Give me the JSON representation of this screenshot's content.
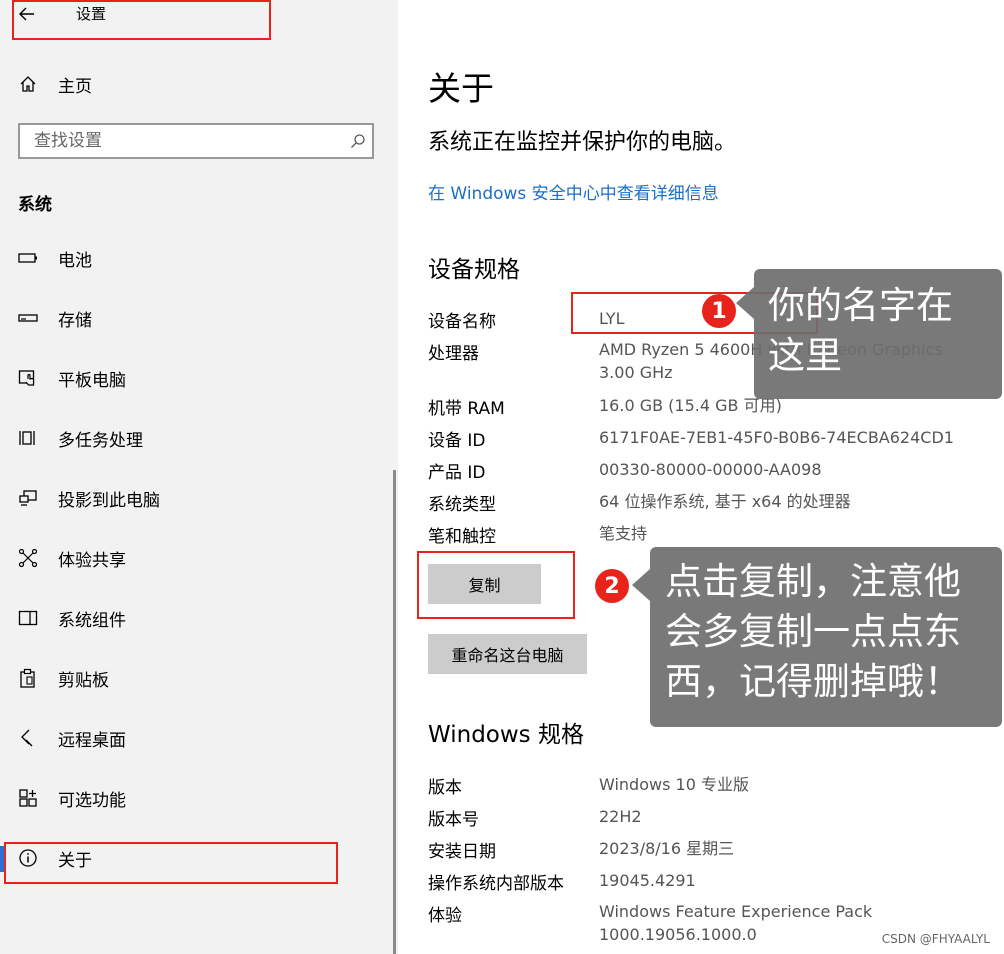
{
  "app": {
    "title": "设置"
  },
  "sidebar": {
    "home_label": "主页",
    "search_placeholder": "查找设置",
    "section": "系统",
    "items": [
      {
        "label": "电池",
        "icon": "battery-icon"
      },
      {
        "label": "存储",
        "icon": "storage-icon"
      },
      {
        "label": "平板电脑",
        "icon": "tablet-icon"
      },
      {
        "label": "多任务处理",
        "icon": "multitasking-icon"
      },
      {
        "label": "投影到此电脑",
        "icon": "project-icon"
      },
      {
        "label": "体验共享",
        "icon": "share-icon"
      },
      {
        "label": "系统组件",
        "icon": "components-icon"
      },
      {
        "label": "剪贴板",
        "icon": "clipboard-icon"
      },
      {
        "label": "远程桌面",
        "icon": "remote-desktop-icon"
      },
      {
        "label": "可选功能",
        "icon": "optional-features-icon"
      },
      {
        "label": "关于",
        "icon": "info-icon",
        "active": true
      }
    ]
  },
  "main": {
    "title": "关于",
    "status": "系统正在监控并保护你的电脑。",
    "security_link": "在 Windows 安全中心中查看详细信息",
    "device_specs": {
      "title": "设备规格",
      "rows": [
        {
          "label": "设备名称",
          "value": "LYL"
        },
        {
          "label": "处理器",
          "value": "AMD Ryzen 5 4600H with Radeon Graphics",
          "value2": "3.00 GHz"
        },
        {
          "label": "机带 RAM",
          "value": "16.0 GB (15.4 GB 可用)"
        },
        {
          "label": "设备 ID",
          "value": "6171F0AE-7EB1-45F0-B0B6-74ECBA624CD1"
        },
        {
          "label": "产品 ID",
          "value": "00330-80000-00000-AA098"
        },
        {
          "label": "系统类型",
          "value": "64 位操作系统, 基于 x64 的处理器"
        },
        {
          "label": "笔和触控",
          "value": "笔支持"
        }
      ],
      "copy_button": "复制",
      "rename_button": "重命名这台电脑"
    },
    "windows_specs": {
      "title": "Windows 规格",
      "rows": [
        {
          "label": "版本",
          "value": "Windows 10 专业版"
        },
        {
          "label": "版本号",
          "value": "22H2"
        },
        {
          "label": "安装日期",
          "value": "2023/8/16 星期三"
        },
        {
          "label": "操作系统内部版本",
          "value": "19045.4291"
        },
        {
          "label": "体验",
          "value": "Windows Feature Experience Pack",
          "value2": "1000.19056.1000.0"
        }
      ]
    }
  },
  "annotations": {
    "badge1": "1",
    "callout1_line1": "你的名字在",
    "callout1_line2": "这里",
    "badge2": "2",
    "callout2_line1": "点击复制，注意他",
    "callout2_line2": "会多复制一点点东",
    "callout2_line3": "西，记得删掉哦！"
  },
  "watermark": "CSDN @FHYAALYL",
  "colors": {
    "accent": "#2b6ed6",
    "link": "#1a6fc9",
    "annotation_red": "#e8231b"
  }
}
